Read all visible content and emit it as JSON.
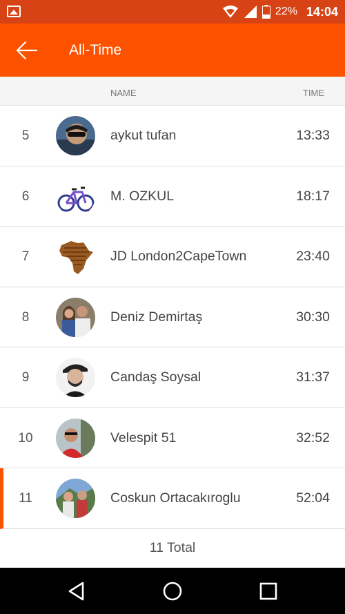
{
  "status_bar": {
    "icons": [
      "gallery-icon",
      "wifi-icon",
      "signal-icon",
      "battery-icon"
    ],
    "battery": "22%",
    "time": "14:04"
  },
  "app_bar": {
    "title": "All-Time",
    "back_icon": "arrow-left-icon",
    "color": "#fc5200"
  },
  "columns": {
    "name": "NAME",
    "time": "TIME"
  },
  "rows": [
    {
      "rank": "5",
      "name": "aykut tufan",
      "time": "13:33"
    },
    {
      "rank": "6",
      "name": "M. OZKUL",
      "time": "18:17"
    },
    {
      "rank": "7",
      "name": "JD London2CapeTown",
      "time": "23:40"
    },
    {
      "rank": "8",
      "name": "Deniz Demirtaş",
      "time": "30:30"
    },
    {
      "rank": "9",
      "name": "Candaş Soysal",
      "time": "31:37"
    },
    {
      "rank": "10",
      "name": "Velespit 51",
      "time": "32:52"
    },
    {
      "rank": "11",
      "name": "Coskun Ortacakıroglu",
      "time": "52:04"
    }
  ],
  "total": "11 Total",
  "nav_bar": {
    "icons": [
      "back-triangle-icon",
      "home-circle-icon",
      "recents-square-icon"
    ]
  }
}
